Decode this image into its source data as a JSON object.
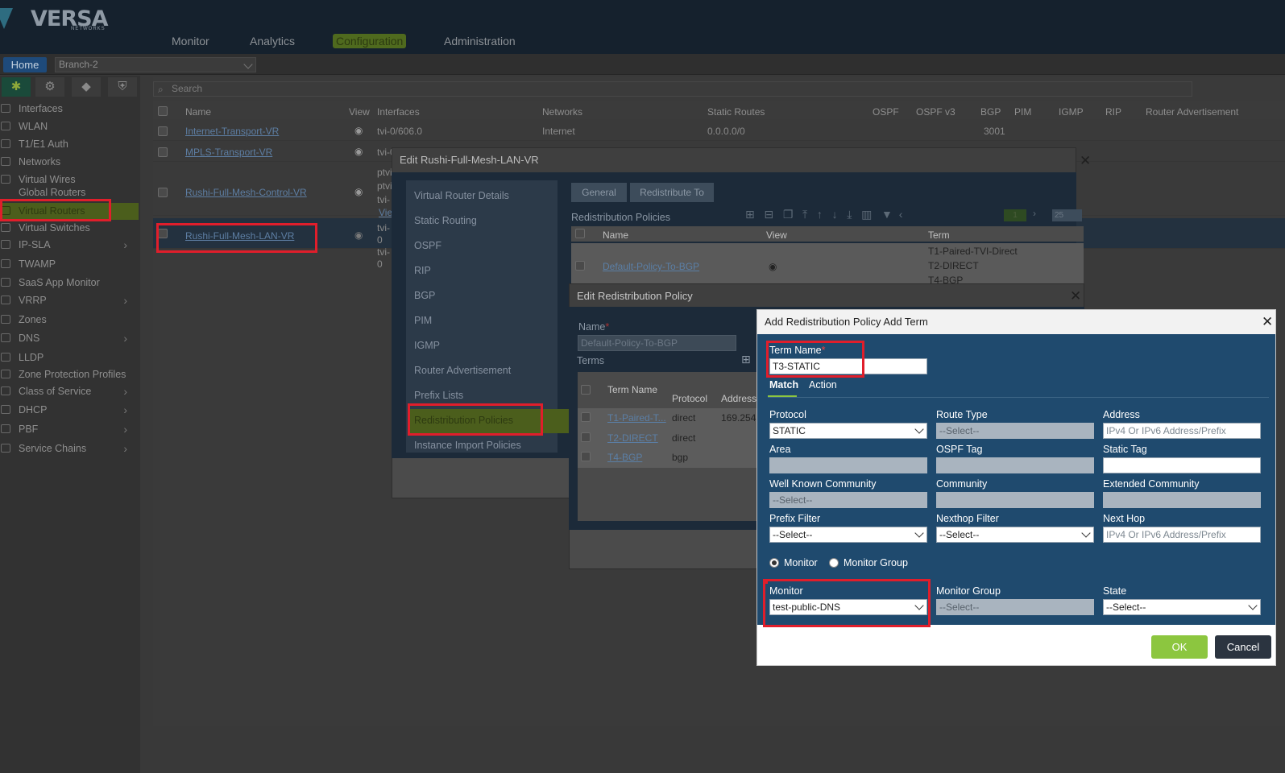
{
  "topnav": {
    "items": [
      "Monitor",
      "Analytics",
      "Configuration",
      "Administration"
    ],
    "active": "Configuration"
  },
  "logo": {
    "text": "VERSA",
    "sub": "NETWORKS"
  },
  "homebar": {
    "home": "Home",
    "branch": "Branch-2"
  },
  "sidebar": {
    "items": [
      "Interfaces",
      "WLAN",
      "T1/E1 Auth",
      "Networks",
      "Virtual Wires",
      "Global Routers",
      "Virtual Routers",
      "Virtual Switches",
      "IP-SLA",
      "TWAMP",
      "SaaS App Monitor",
      "VRRP",
      "Zones",
      "DNS",
      "LLDP",
      "Zone Protection Profiles",
      "Class of Service",
      "DHCP",
      "PBF",
      "Service Chains"
    ]
  },
  "search": {
    "placeholder": "Search"
  },
  "grid": {
    "headers": [
      "Name",
      "View",
      "Interfaces",
      "Networks",
      "Static Routes",
      "OSPF",
      "OSPF v3",
      "BGP",
      "PIM",
      "IGMP",
      "RIP",
      "Router Advertisement"
    ],
    "rows": [
      {
        "name": "Internet-Transport-VR",
        "interfaces": "tvi-0/606.0",
        "networks": "Internet",
        "static": "0.0.0.0/0",
        "bgp": "3001"
      },
      {
        "name": "MPLS-Transport-VR",
        "interfaces": "tvi-0",
        "networks": "",
        "static": "",
        "bgp": ""
      },
      {
        "name": "Rushi-Full-Mesh-Control-VR",
        "interfaces": "ptvi ptvi tvi-",
        "networks": "",
        "static": "",
        "bgp": ""
      },
      {
        "name": "Rushi-Full-Mesh-LAN-VR",
        "interfaces": "tvi-0 tvi-0",
        "networks": "",
        "static": "",
        "bgp": ""
      }
    ],
    "partial_view": "Vie"
  },
  "dlg_vr": {
    "title": "Edit Rushi-Full-Mesh-LAN-VR",
    "menu": [
      "Virtual Router Details",
      "Static Routing",
      "OSPF",
      "RIP",
      "BGP",
      "PIM",
      "IGMP",
      "Router Advertisement",
      "Prefix Lists",
      "Redistribution Policies",
      "Instance Import Policies"
    ],
    "tabs": [
      "General",
      "Redistribute To"
    ],
    "section": "Redistribution Policies",
    "pager": {
      "page": "1",
      "size": "25"
    },
    "table_headers": [
      "Name",
      "View",
      "Term"
    ],
    "policy": {
      "name": "Default-Policy-To-BGP",
      "terms": [
        "T1-Paired-TVI-Direct",
        "T2-DIRECT",
        "T4-BGP"
      ]
    }
  },
  "dlg_policy": {
    "title": "Edit Redistribution Policy",
    "name_label": "Name",
    "name_value": "Default-Policy-To-BGP",
    "terms_label": "Terms",
    "headers": [
      "Term Name",
      "Protocol",
      "Address"
    ],
    "rows": [
      {
        "term": "T1-Paired-T...",
        "protocol": "direct",
        "address": "169.254."
      },
      {
        "term": "T2-DIRECT",
        "protocol": "direct",
        "address": ""
      },
      {
        "term": "T4-BGP",
        "protocol": "bgp",
        "address": ""
      }
    ]
  },
  "dlg_term": {
    "title": "Add Redistribution Policy Add Term",
    "term_name_label": "Term Name",
    "term_name_value": "T3-STATIC",
    "tabs": [
      "Match",
      "Action"
    ],
    "fields": {
      "protocol": {
        "label": "Protocol",
        "value": "STATIC"
      },
      "route_type": {
        "label": "Route Type",
        "value": "--Select--"
      },
      "address": {
        "label": "Address",
        "placeholder": "IPv4 Or IPv6 Address/Prefix"
      },
      "area": {
        "label": "Area"
      },
      "ospf_tag": {
        "label": "OSPF Tag"
      },
      "static_tag": {
        "label": "Static Tag"
      },
      "wk_community": {
        "label": "Well Known Community",
        "value": "--Select--"
      },
      "community": {
        "label": "Community"
      },
      "ext_community": {
        "label": "Extended Community"
      },
      "prefix_filter": {
        "label": "Prefix Filter",
        "value": "--Select--"
      },
      "nexthop_filter": {
        "label": "Nexthop Filter",
        "value": "--Select--"
      },
      "next_hop": {
        "label": "Next Hop",
        "placeholder": "IPv4 Or IPv6 Address/Prefix"
      },
      "monitor": {
        "label": "Monitor",
        "value": "test-public-DNS"
      },
      "monitor_group": {
        "label": "Monitor Group",
        "value": "--Select--"
      },
      "state": {
        "label": "State",
        "value": "--Select--"
      }
    },
    "radio": {
      "monitor": "Monitor",
      "monitor_group": "Monitor Group",
      "selected": "Monitor"
    },
    "ok": "OK",
    "cancel": "Cancel"
  },
  "colors": {
    "accent": "#8cc63f",
    "dialog_body": "#1f4a6e",
    "highlight": "#e01e2b"
  }
}
